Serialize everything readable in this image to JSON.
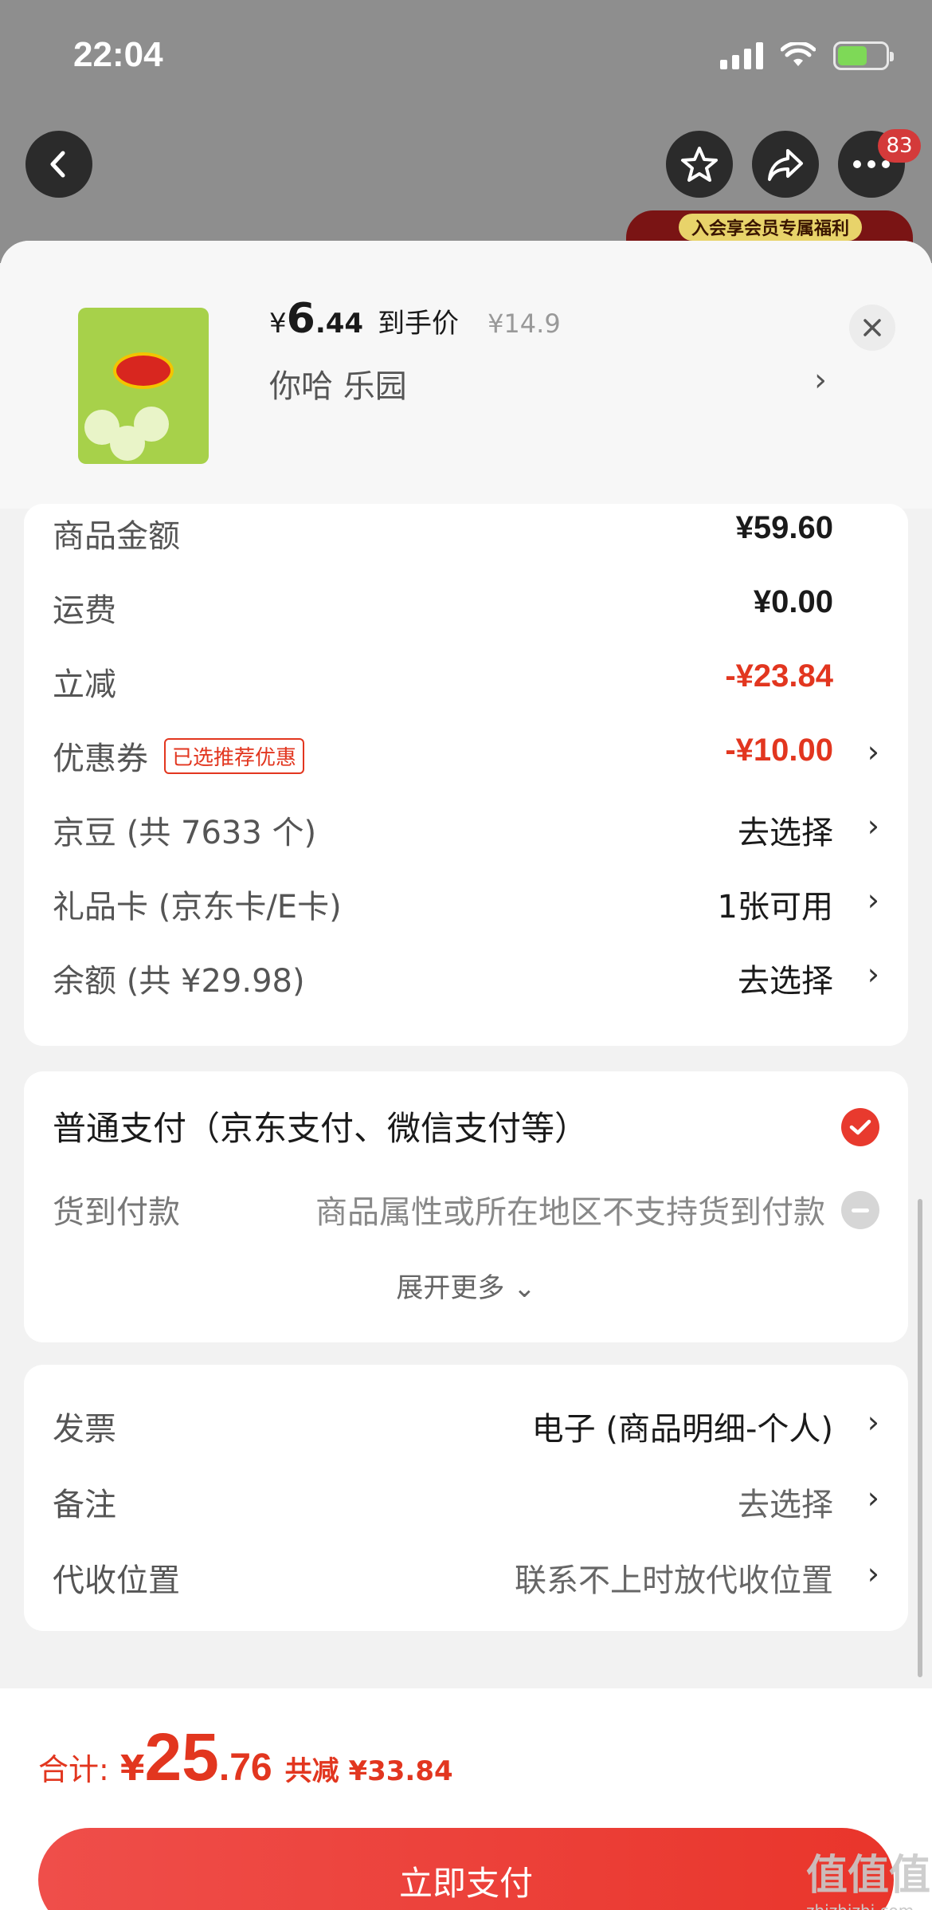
{
  "status": {
    "time": "22:04"
  },
  "nav": {
    "badge_count": "83"
  },
  "banner": {
    "text": "入会享会员专属福利"
  },
  "product": {
    "price_symbol": "¥",
    "price_int": "6",
    "price_dec": ".44",
    "price_label": "到手价",
    "original_price": "¥14.9",
    "spec": "你哈  乐园",
    "arrow": "›"
  },
  "summary": {
    "rows": [
      {
        "label": "商品金额",
        "value": "¥59.60"
      },
      {
        "label": "运费",
        "value": "¥0.00"
      },
      {
        "label": "立减",
        "value": "-¥23.84"
      },
      {
        "label": "优惠券",
        "tag": "已选推荐优惠",
        "value": "-¥10.00",
        "arrow": "›"
      },
      {
        "label": "京豆 (共 7633 个)",
        "value": "去选择",
        "arrow": "›"
      },
      {
        "label": "礼品卡 (京东卡/E卡)",
        "value": "1张可用",
        "arrow": "›"
      },
      {
        "label": "余额 (共 ¥29.98)",
        "value": "去选择",
        "arrow": "›"
      }
    ]
  },
  "payment": {
    "normal": "普通支付（京东支付、微信支付等）",
    "cod_label": "货到付款",
    "cod_note": "商品属性或所在地区不支持货到付款",
    "expand": "展开更多 ⌄"
  },
  "extras": {
    "rows": [
      {
        "label": "发票",
        "value": "电子 (商品明细-个人)",
        "arrow": "›"
      },
      {
        "label": "备注",
        "value": "去选择",
        "arrow": "›"
      },
      {
        "label": "代收位置",
        "value": "联系不上时放代收位置",
        "arrow": "›"
      }
    ]
  },
  "footer": {
    "total_label": "合计:",
    "total_symbol": "¥",
    "total_int": "25",
    "total_dec": ".76",
    "saved": "共减 ¥33.84",
    "pay_button": "立即支付"
  },
  "watermark": {
    "logo": "值值值",
    "site": "zhizhizhi.com"
  },
  "colors": {
    "accent": "#e2361f",
    "button": "#e9352b",
    "backdrop": "#8e8e8e"
  }
}
